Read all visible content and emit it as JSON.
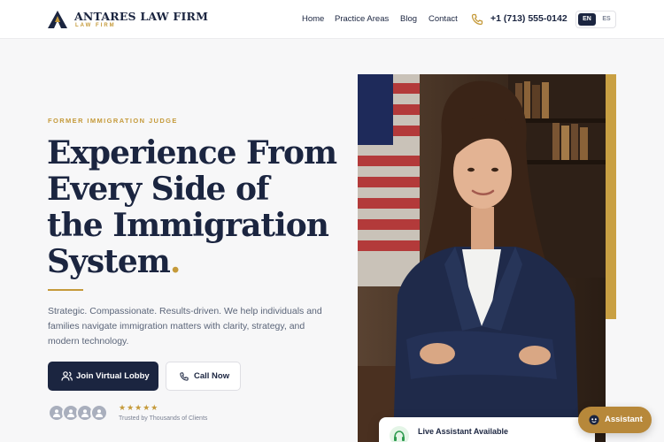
{
  "brand": {
    "name": "ANTARES LAW FIRM",
    "tagline": "LAW FIRM",
    "colors": {
      "navy": "#1b2540",
      "gold": "#c59a3a"
    }
  },
  "nav": {
    "items": [
      {
        "label": "Home"
      },
      {
        "label": "Practice Areas"
      },
      {
        "label": "Blog"
      },
      {
        "label": "Contact"
      }
    ],
    "phone": "+1 (713) 555-0142",
    "languages": {
      "active": "EN",
      "other": "ES"
    }
  },
  "hero": {
    "eyebrow": "FORMER IMMIGRATION JUDGE",
    "headline": {
      "line1": "Experience From",
      "line2": "Every Side of",
      "line3": "the Immigration",
      "line4": "System",
      "dot": "."
    },
    "description": "Strategic. Compassionate. Results-driven. We help individuals and families navigate immigration matters with clarity, strategy, and modern technology.",
    "primary_cta": "Join Virtual Lobby",
    "secondary_cta": "Call Now",
    "rating_stars": "★★★★★",
    "trusted_text": "Trusted by Thousands of Clients"
  },
  "widgets": {
    "live_assistant": "Live Assistant Available",
    "assistant_button": "Assistant"
  }
}
